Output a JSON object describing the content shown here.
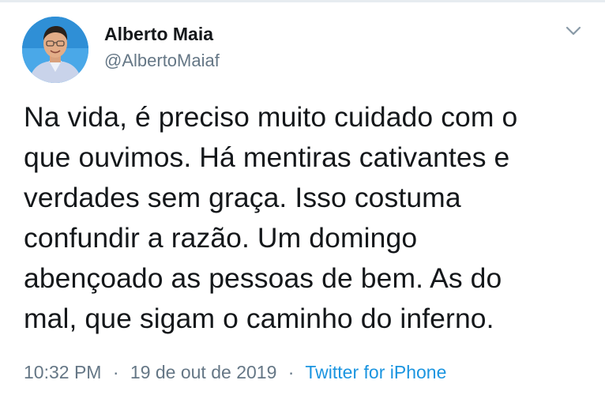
{
  "user": {
    "display_name": "Alberto Maia",
    "handle": "@AlbertoMaiaf"
  },
  "tweet": {
    "lines": [
      "Na vida, é preciso muito cuidado com o",
      "que ouvimos. Há mentiras cativantes e",
      "verdades sem graça. Isso costuma",
      "confundir a razão. Um domingo",
      "abençoado as pessoas de bem. As do",
      "mal, que sigam o caminho do inferno."
    ],
    "time": "10:32 PM",
    "date": "19 de out de 2019",
    "separator": "·",
    "source": "Twitter for iPhone"
  },
  "icons": {
    "menu": "chevron-down-icon"
  },
  "colors": {
    "text": "#14171a",
    "secondary": "#657786",
    "link": "#1b95e0",
    "avatar_bg": "#4aa8e8"
  }
}
